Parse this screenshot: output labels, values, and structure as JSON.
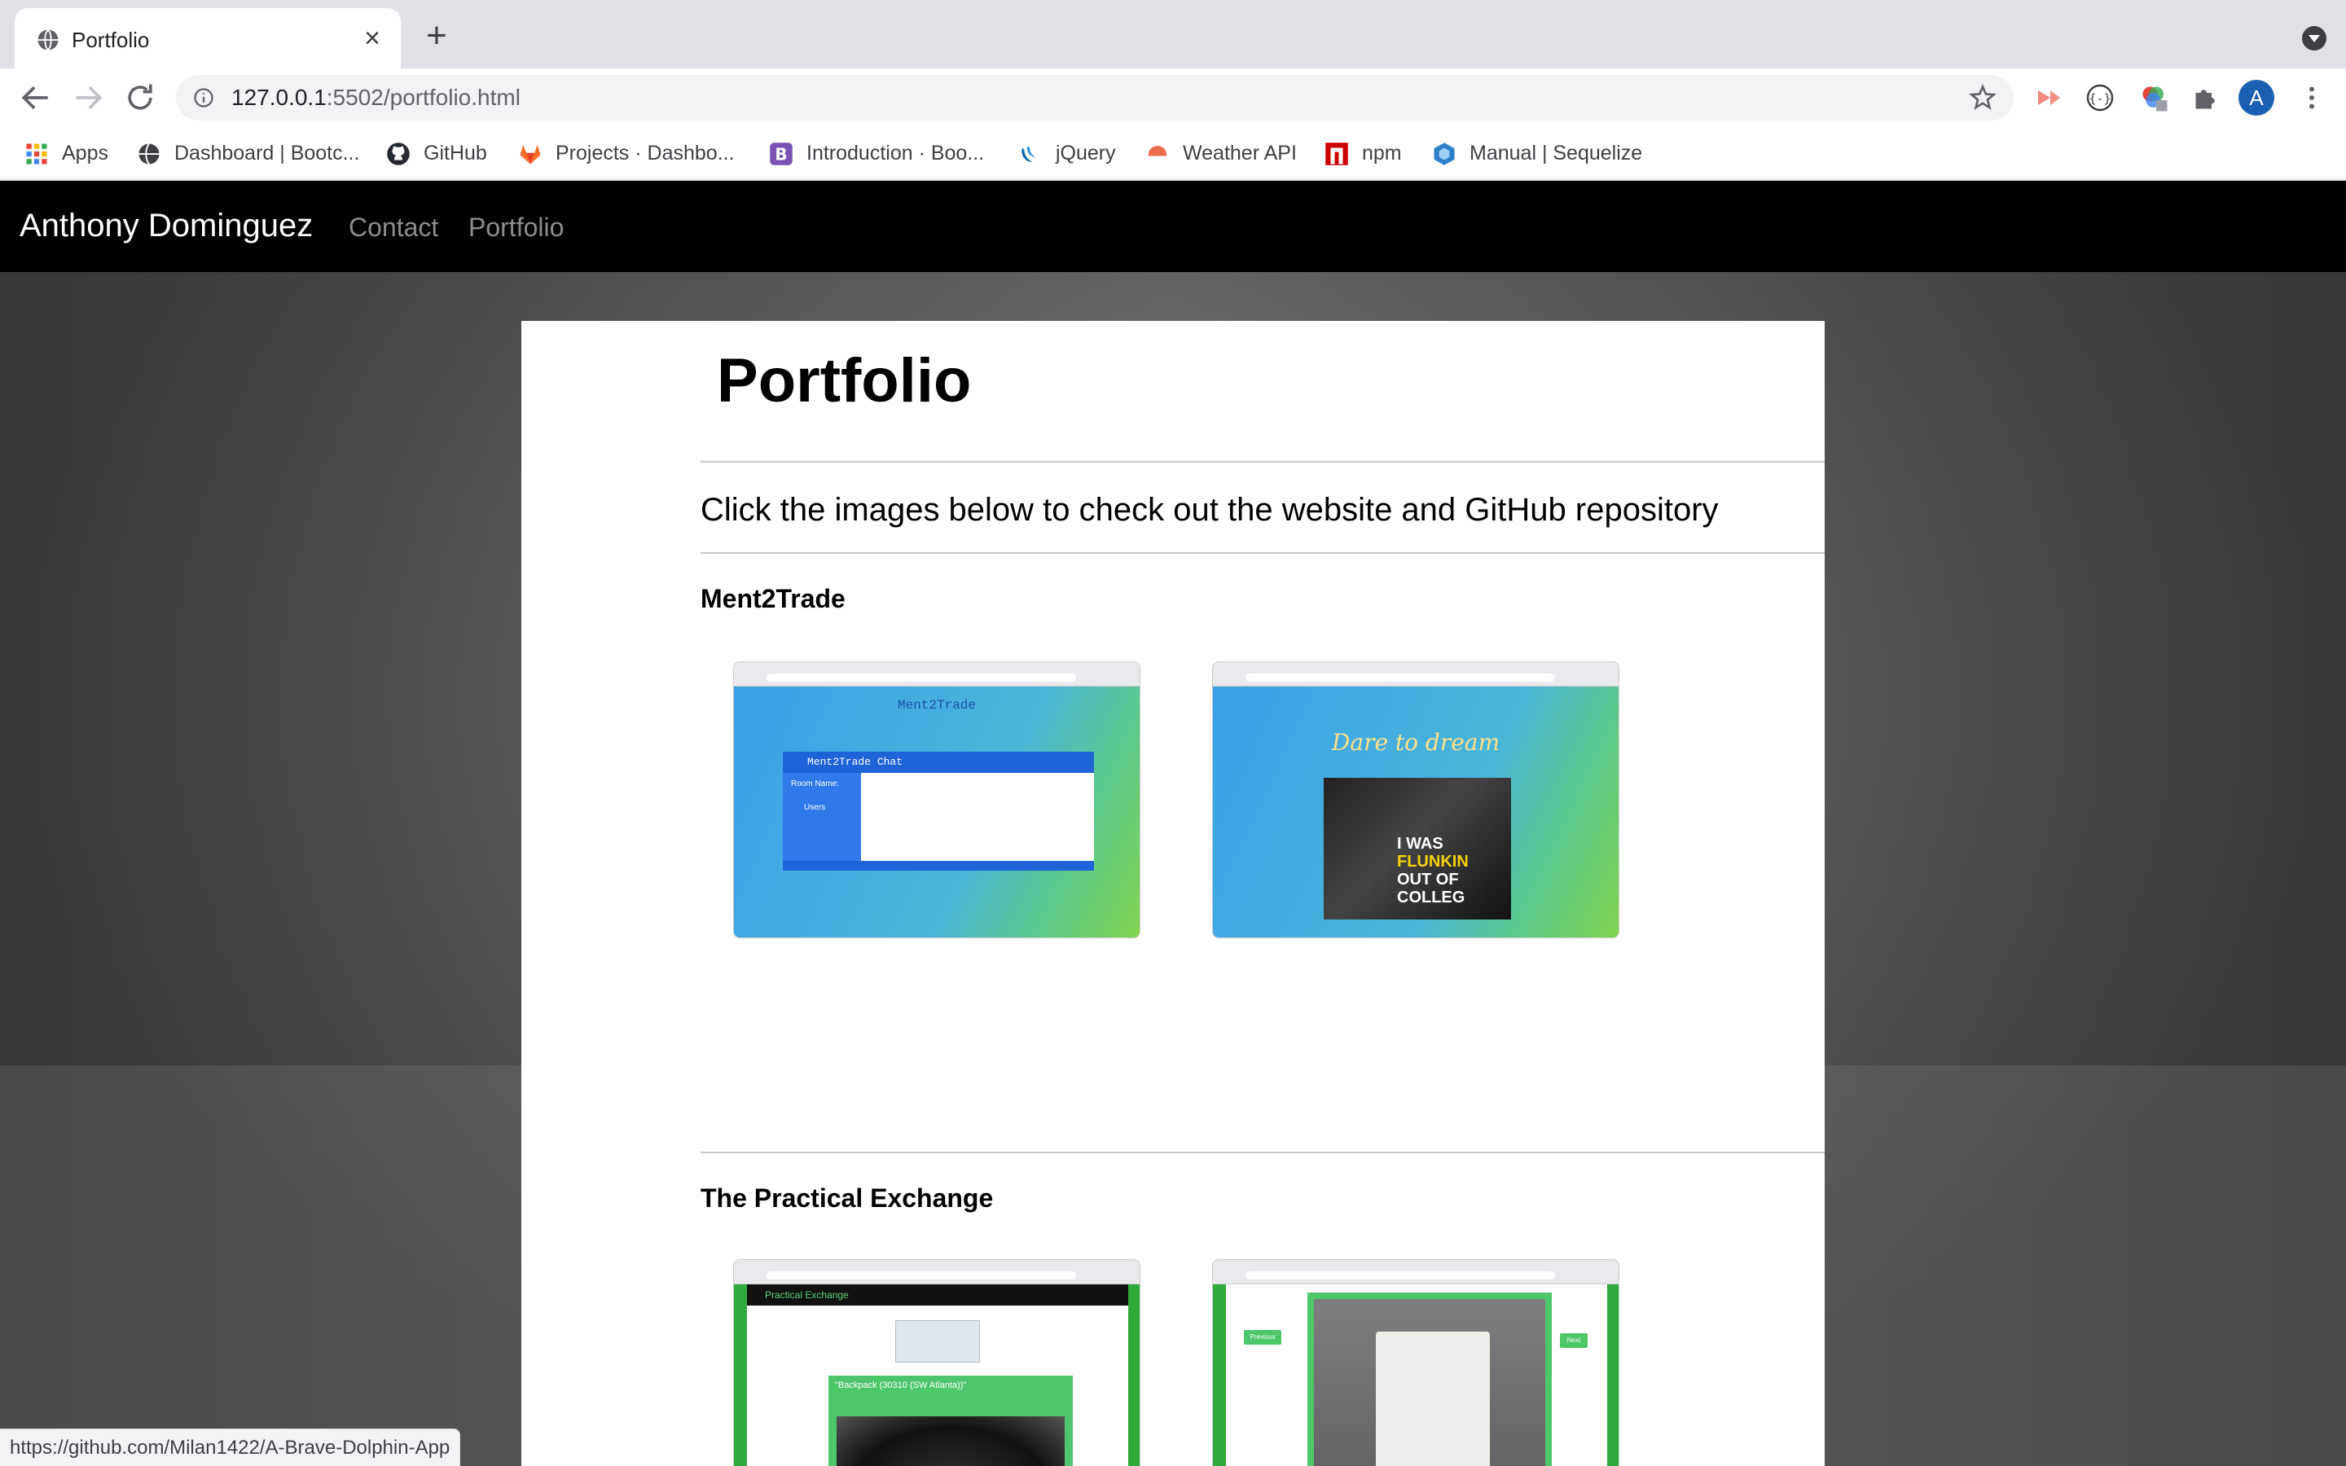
{
  "browser": {
    "tab_title": "Portfolio",
    "url_host": "127.0.0.1",
    "url_rest": ":5502/portfolio.html",
    "avatar_letter": "A",
    "status_url": "https://github.com/Milan1422/A-Brave-Dolphin-App"
  },
  "bookmarks": [
    {
      "label": "Apps",
      "icon": "apps-grid-icon"
    },
    {
      "label": "Dashboard | Bootc...",
      "icon": "globe-icon"
    },
    {
      "label": "GitHub",
      "icon": "github-icon"
    },
    {
      "label": "Projects · Dashbo...",
      "icon": "gitlab-icon"
    },
    {
      "label": "Introduction · Boo...",
      "icon": "bootstrap-icon"
    },
    {
      "label": "jQuery",
      "icon": "jquery-icon"
    },
    {
      "label": "Weather API",
      "icon": "weather-icon"
    },
    {
      "label": "npm",
      "icon": "npm-icon"
    },
    {
      "label": "Manual | Sequelize",
      "icon": "sequelize-icon"
    }
  ],
  "site": {
    "brand": "Anthony Dominguez",
    "nav": [
      "Contact",
      "Portfolio"
    ],
    "heading": "Portfolio",
    "lead": "Click the images below to check out the website and GitHub repository",
    "sections": [
      {
        "title": "Ment2Trade",
        "shots": [
          {
            "app_title": "Ment2Trade",
            "panel_title": "Ment2Trade Chat",
            "side_label": "Room Name:",
            "users_label": "Users"
          },
          {
            "headline": "Dare to dream",
            "video_caption_1": "I WAS",
            "video_caption_2": "FLUNKIN",
            "video_caption_3": "OUT OF COLLEG"
          }
        ]
      },
      {
        "title": "The Practical Exchange",
        "shots": [
          {
            "app_title": "Practical Exchange",
            "item_title": "\"Backpack (30310 (SW Atlanta))\""
          },
          {
            "prev_label": "Previous",
            "next_label": "Next"
          }
        ]
      }
    ]
  },
  "colors": {
    "nav_bg": "#000000",
    "accent_green": "#2faa3d",
    "chat_blue": "#1f63d8"
  }
}
